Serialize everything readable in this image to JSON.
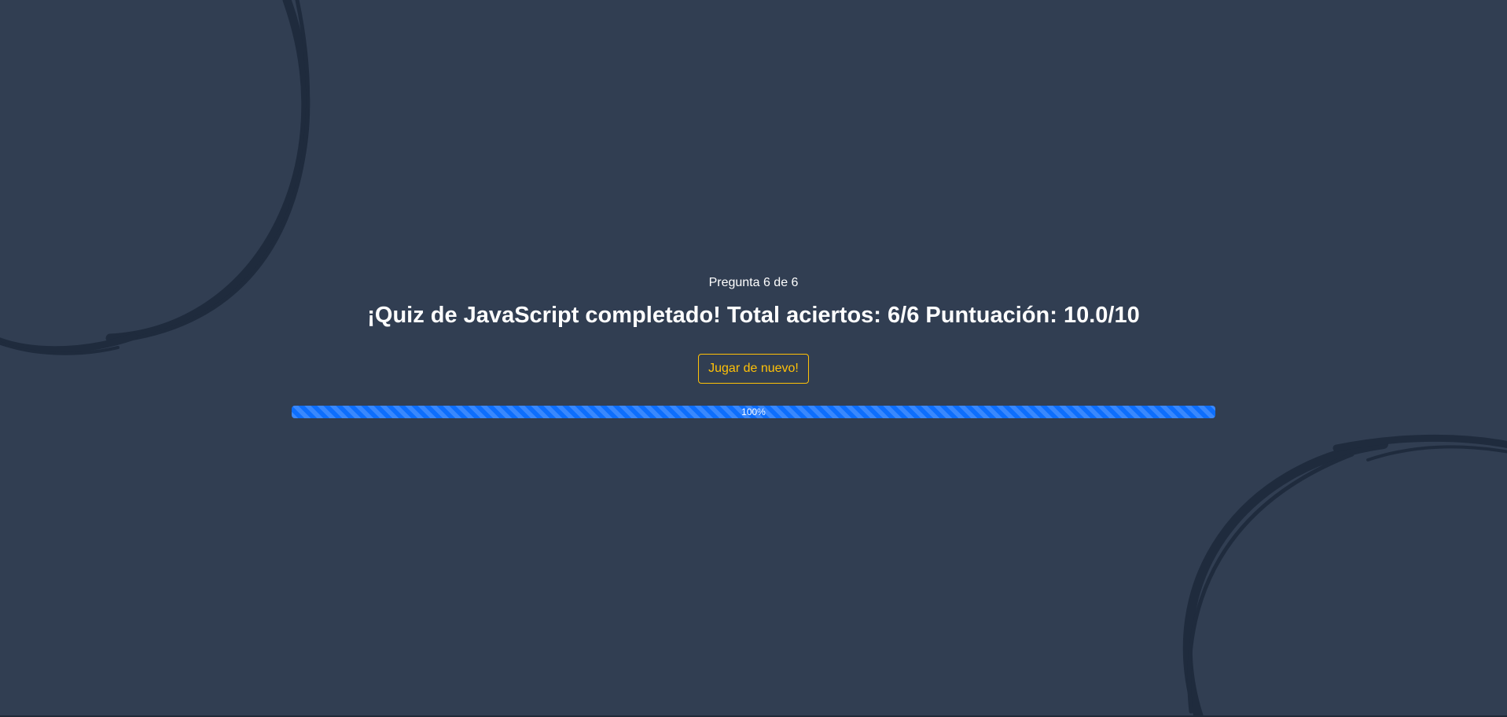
{
  "quiz": {
    "counter": "Pregunta 6 de 6",
    "result": "¡Quiz de JavaScript completado! Total aciertos: 6/6 Puntuación: 10.0/10",
    "replay_label": "Jugar de nuevo!",
    "progress": {
      "value_percent": 100,
      "label": "100%"
    }
  },
  "colors": {
    "background": "#313e52",
    "decoration": "#1f2b3d",
    "accent": "#ffc107",
    "progress": "#0d6efd"
  }
}
